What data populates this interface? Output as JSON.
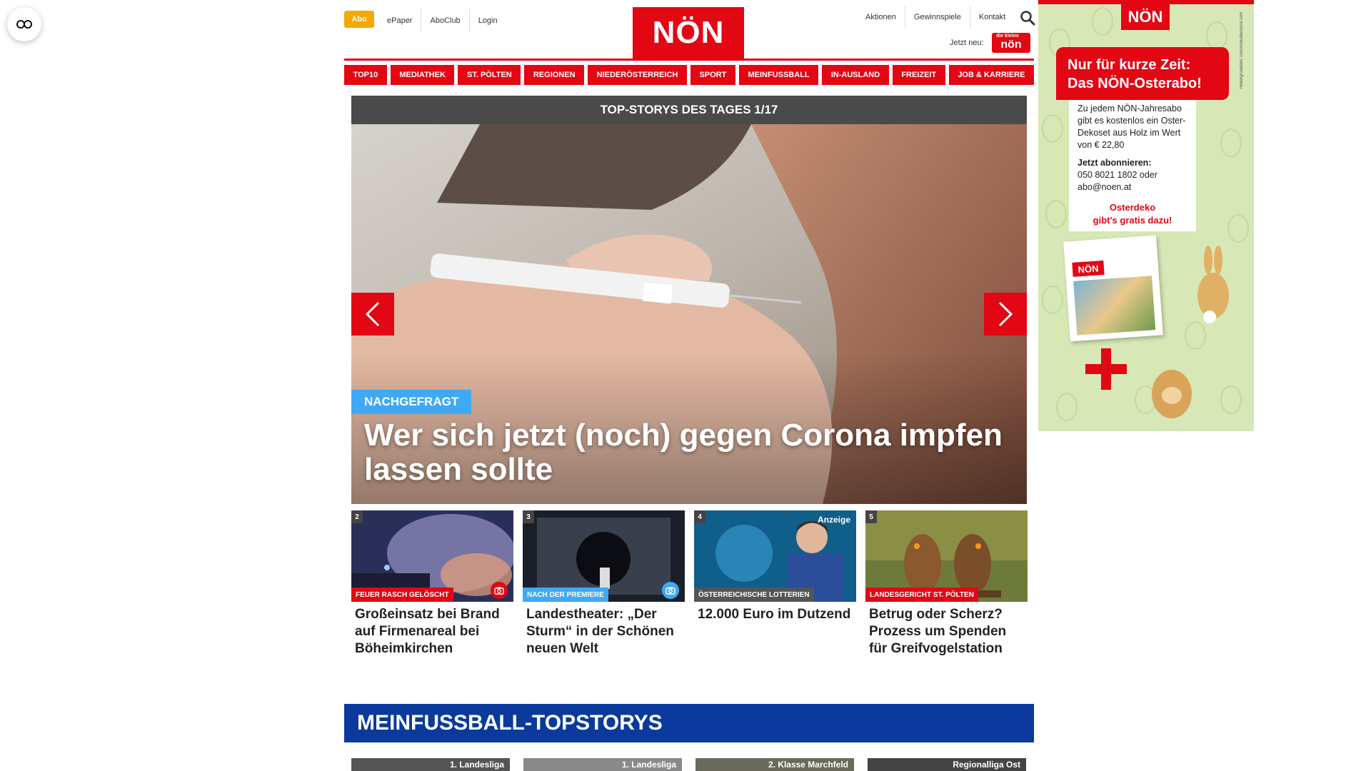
{
  "header": {
    "abo_label": "Abo",
    "top_links": [
      "ePaper",
      "AboClub",
      "Login"
    ],
    "right_links": [
      "Aktionen",
      "Gewinnspiele",
      "Kontakt"
    ],
    "logo_text": "NÖN",
    "jetzt_neu": "Jetzt neu:",
    "mini_logo_top": "die kleine",
    "mini_logo_text": "nön"
  },
  "nav": [
    "TOP10",
    "MEDIATHEK",
    "ST. PÖLTEN",
    "REGIONEN",
    "NIEDERÖSTERREICH",
    "SPORT",
    "MEINFUSSBALL",
    "IN-AUSLAND",
    "FREIZEIT",
    "JOB & KARRIERE"
  ],
  "hero": {
    "heading": "TOP-STORYS DES TAGES 1/17",
    "tag": "NACHGEFRAGT",
    "title": "Wer sich jetzt (noch) gegen Corona impfen lassen sollte"
  },
  "stories": [
    {
      "num": "2",
      "tag": "FEUER RASCH GELÖSCHT",
      "tag_color": "#e30613",
      "title": "Großeinsatz bei Brand auf Firmenareal bei Böheimkirchen",
      "icon": "camera-icon",
      "icon_color": "#e30613"
    },
    {
      "num": "3",
      "tag": "NACH DER PREMIERE",
      "tag_color": "#3fa9f5",
      "title": "Landestheater: „Der Sturm“ in der Schönen neuen Welt",
      "icon": "camera-icon",
      "icon_color": "#3fa9f5"
    },
    {
      "num": "4",
      "tag": "ÖSTERREICHISCHE LOTTERIEN",
      "tag_color": "#555555",
      "title": "12.000 Euro im Dutzend",
      "badge": "Anzeige"
    },
    {
      "num": "5",
      "tag": "LANDESGERICHT ST. PÖLTEN",
      "tag_color": "#e30613",
      "title": "Betrug oder Scherz? Prozess um Spenden für Greifvogelstation"
    }
  ],
  "section": {
    "title": "MEINFUSSBALL-TOPSTORYS",
    "cards": [
      "1. Landesliga",
      "1. Landesliga",
      "2. Klasse Marchfeld",
      "Regionalliga Ost"
    ]
  },
  "ad": {
    "logo": "NÖN",
    "headline_1": "Nur für kurze Zeit:",
    "headline_2": "Das NÖN-Osterabo!",
    "body": "Zu jedem NÖN-Jahresabo gibt es kostenlos ein Oster-Dekoset aus Holz im Wert von € 22,80",
    "cta_label": "Jetzt abonnieren:",
    "cta_text": "050 8021 1802 oder abo@noen.at",
    "promo_1": "Osterdeko",
    "promo_2": "gibt's gratis dazu!",
    "side_text": "Hintergrundbild: iStock/shutterstock.com",
    "mag_logo": "NÖN"
  },
  "colors": {
    "brand_red": "#e30613",
    "accent_blue": "#3fa9f5",
    "section_blue": "#0b3a9c",
    "abo_orange": "#f5a800"
  }
}
